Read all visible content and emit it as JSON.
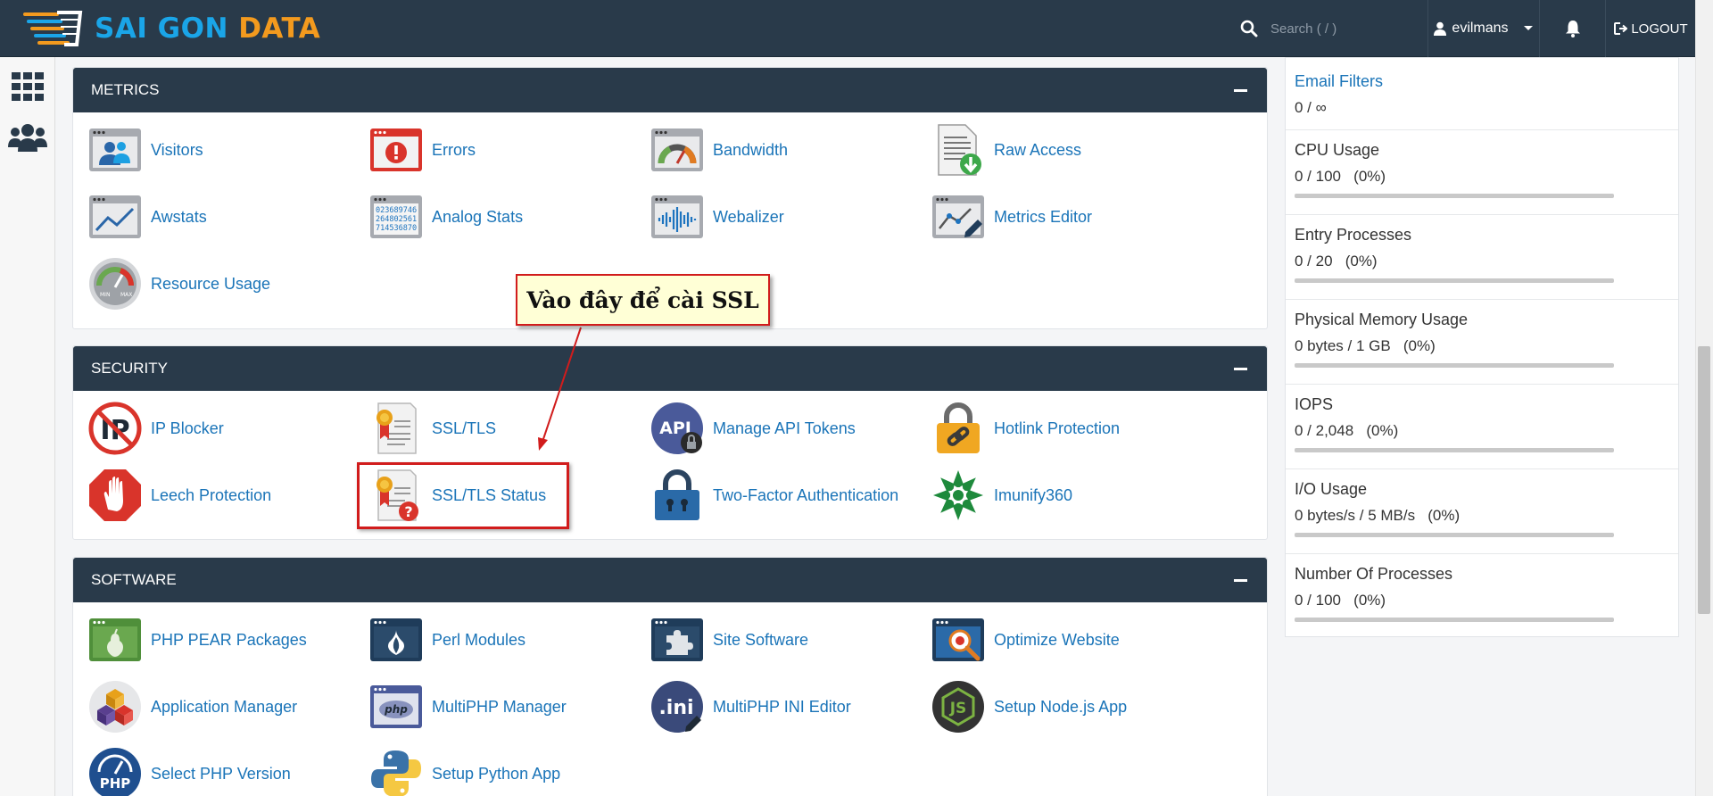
{
  "brand": {
    "part1": "SAI GON",
    "part2": "DATA"
  },
  "header": {
    "search_placeholder": "Search ( / )",
    "username": "evilmans",
    "logout_label": "LOGOUT"
  },
  "sections": {
    "metrics": {
      "title": "METRICS",
      "items": [
        "Visitors",
        "Errors",
        "Bandwidth",
        "Raw Access",
        "Awstats",
        "Analog Stats",
        "Webalizer",
        "Metrics Editor",
        "Resource Usage"
      ],
      "analog_digits": [
        "023689746",
        "264802561",
        "714536870"
      ]
    },
    "security": {
      "title": "SECURITY",
      "items": [
        "IP Blocker",
        "SSL/TLS",
        "Manage API Tokens",
        "Hotlink Protection",
        "Leech Protection",
        "SSL/TLS Status",
        "Two-Factor Authentication",
        "Imunify360"
      ]
    },
    "software": {
      "title": "SOFTWARE",
      "items": [
        "PHP PEAR Packages",
        "Perl Modules",
        "Site Software",
        "Optimize Website",
        "Application Manager",
        "MultiPHP Manager",
        "MultiPHP INI Editor",
        "Setup Node.js App",
        "Select PHP Version",
        "Setup Python App"
      ]
    }
  },
  "stats": [
    {
      "name": "Email Filters",
      "value": "0 / ∞",
      "bar": false
    },
    {
      "name": "CPU Usage",
      "value": "0 / 100   (0%)",
      "bar": true,
      "percent": 0
    },
    {
      "name": "Entry Processes",
      "value": "0 / 20   (0%)",
      "bar": true,
      "percent": 0
    },
    {
      "name": "Physical Memory Usage",
      "value": "0 bytes / 1 GB   (0%)",
      "bar": true,
      "percent": 0
    },
    {
      "name": "IOPS",
      "value": "0 / 2,048   (0%)",
      "bar": true,
      "percent": 0
    },
    {
      "name": "I/O Usage",
      "value": "0 bytes/s / 5 MB/s   (0%)",
      "bar": true,
      "percent": 0
    },
    {
      "name": "Number Of Processes",
      "value": "0 / 100   (0%)",
      "bar": true,
      "percent": 0
    }
  ],
  "annotation": {
    "text": "Vào đây để cài SSL"
  },
  "icon_text": {
    "api": "API",
    "php_logo": "php",
    "ini": ".ini",
    "js": "JS",
    "php_ver": "PHP"
  },
  "colors": {
    "header_bg": "#293a4a",
    "link": "#1a74b8",
    "highlight": "#d11c1c",
    "brand_blue": "#1aa5e8",
    "brand_orange": "#f39a1e"
  }
}
